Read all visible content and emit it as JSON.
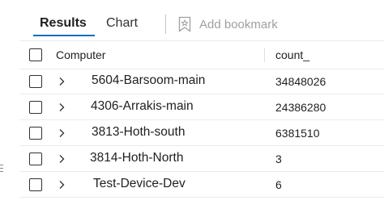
{
  "tabs": {
    "results": "Results",
    "chart": "Chart"
  },
  "toolbar": {
    "add_bookmark": "Add bookmark"
  },
  "table": {
    "columns": {
      "computer": "Computer",
      "count": "count_"
    },
    "rows": [
      {
        "computer": "5604-Barsoom-main",
        "count": "34848026"
      },
      {
        "computer": "4306-Arrakis-main",
        "count": "24386280"
      },
      {
        "computer": "3813-Hoth-south",
        "count": "6381510"
      },
      {
        "computer": "3814-Hoth-North",
        "count": "3"
      },
      {
        "computer": "Test-Device-Dev",
        "count": "6"
      }
    ]
  },
  "colors": {
    "accent": "#0f6cbd",
    "divider": "#edebe9",
    "muted_text": "#a19f9d"
  }
}
